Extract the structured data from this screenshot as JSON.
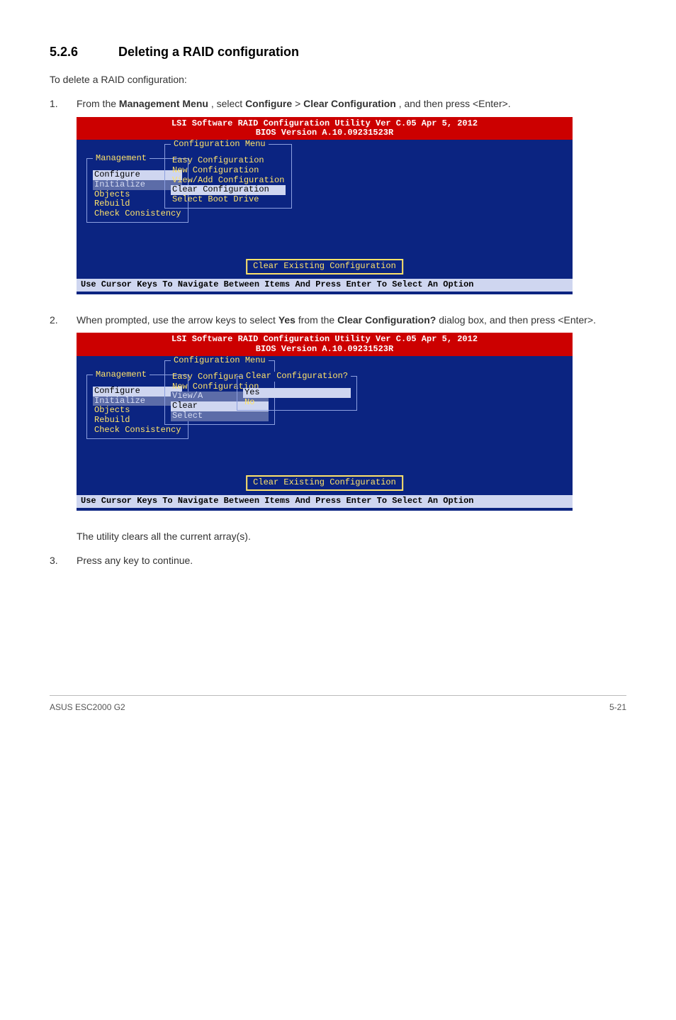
{
  "heading": {
    "number": "5.2.6",
    "title": "Deleting a RAID configuration"
  },
  "intro": "To delete a RAID configuration:",
  "steps": {
    "s1": {
      "num": "1.",
      "pre": "From the ",
      "b1": "Management Menu",
      "mid1": ", select ",
      "b2": "Configure",
      "gt": " > ",
      "b3": "Clear Configuration",
      "post": ", and then press <Enter>."
    },
    "s2": {
      "num": "2.",
      "pre": "When prompted, use the arrow keys to select ",
      "b1": "Yes",
      "mid": " from the ",
      "b2": "Clear Configuration?",
      "post": " dialog box, and then press <Enter>."
    },
    "s3": {
      "num": "3.",
      "text": "Press any key to continue."
    }
  },
  "conclusion": "The utility clears all the current array(s).",
  "bios": {
    "header1": "LSI Software RAID Configuration Utility Ver C.05 Apr 5, 2012",
    "header2": "BIOS Version  A.10.09231523R",
    "mgmt_title": "Management",
    "mgmt": [
      "Configure",
      "Initialize",
      "Objects",
      "Rebuild",
      "Check Consistency"
    ],
    "cfg_title": "Configuration Menu",
    "cfg": [
      "Easy Configuration",
      "New Configuration",
      "View/Add Configuration",
      "Clear Configuration",
      "Select Boot Drive"
    ],
    "cfg2_trunc": {
      "view": "View/A",
      "clear": "Clear",
      "select": "Select"
    },
    "clear_title": "Clear Configuration?",
    "clear_opts": [
      "Yes",
      "No"
    ],
    "status": "Clear Existing Configuration",
    "footer": "Use Cursor Keys To Navigate Between Items And Press Enter To Select An Option"
  },
  "pagefoot": {
    "left": "ASUS ESC2000 G2",
    "right": "5-21"
  }
}
